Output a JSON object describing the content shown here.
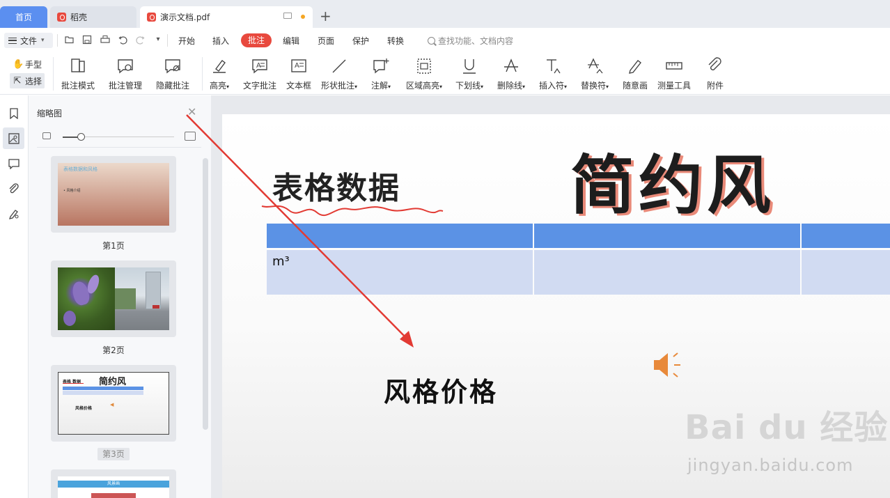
{
  "tabs": {
    "home": "首页",
    "daoke": "稻壳",
    "document": "演示文档.pdf",
    "new_tab": "+"
  },
  "menu": {
    "file": "文件",
    "items": [
      "开始",
      "插入",
      "批注",
      "编辑",
      "页面",
      "保护",
      "转换"
    ],
    "active": "批注",
    "search_placeholder": "查找功能、文档内容"
  },
  "ribbon": {
    "hand": "手型",
    "select": "选择",
    "buttons": [
      "批注模式",
      "批注管理",
      "隐藏批注",
      "高亮",
      "文字批注",
      "文本框",
      "形状批注",
      "注解",
      "区域高亮",
      "下划线",
      "删除线",
      "插入符",
      "替换符",
      "随意画",
      "测量工具",
      "附件"
    ]
  },
  "thumbnail_panel": {
    "title": "缩略图",
    "pages": [
      "第1页",
      "第2页",
      "第3页"
    ],
    "current_page": "第3页",
    "thumb1_title": "表格数据和风格",
    "thumb1_bullet": "• 风格介绍",
    "thumb3_title_a": "表格 数据",
    "thumb3_title_b": "简约风",
    "thumb3_sub": "风格价格",
    "thumb4_title": "风景画"
  },
  "document": {
    "heading_small": "表格数据",
    "heading_big": "简约风",
    "table_cell": "m³",
    "subtitle": "风格价格",
    "watermark_main": "Bai du 经验",
    "watermark_url": "jingyan.baidu.com"
  },
  "colors": {
    "accent_red": "#e8493e",
    "home_tab": "#5b8ff0",
    "table_header": "#5b92e5",
    "table_row": "#d1dbf2",
    "title_shadow": "#e98a79"
  }
}
